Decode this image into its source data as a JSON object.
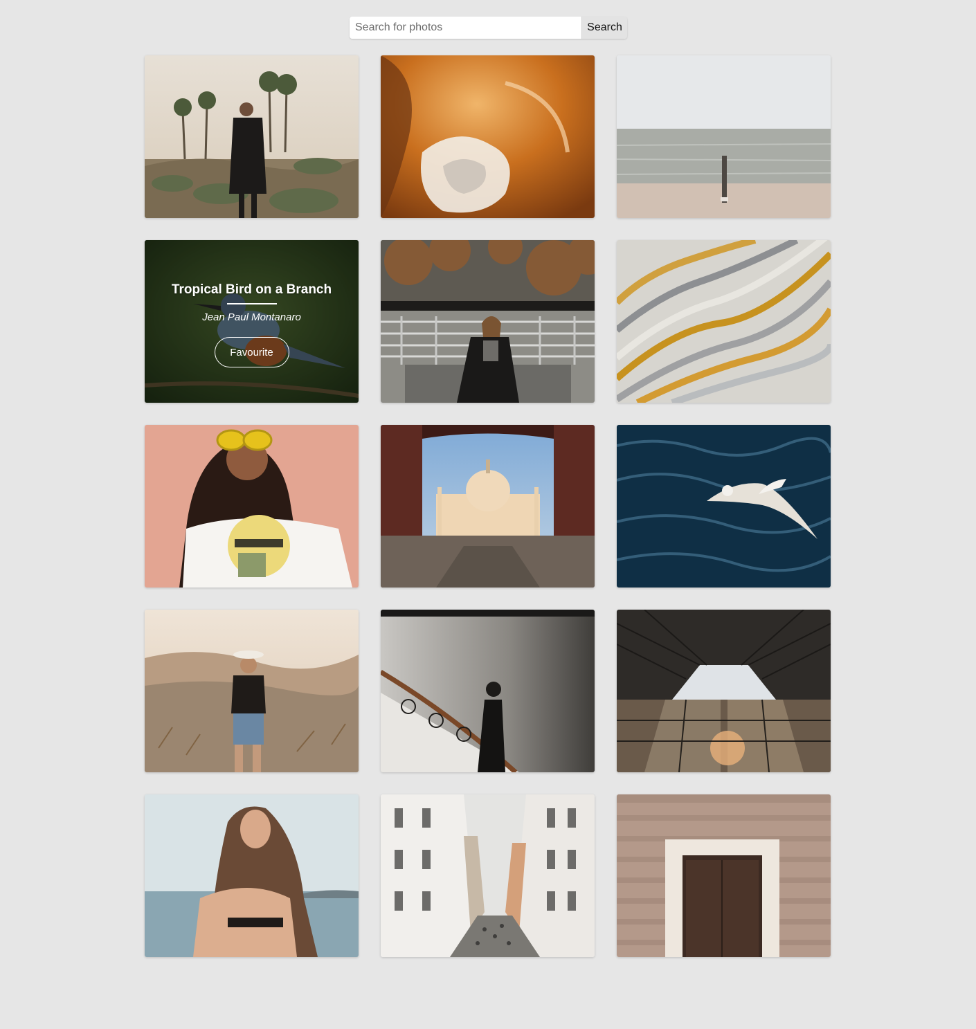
{
  "search": {
    "placeholder": "Search for photos",
    "value": "",
    "button_label": "Search"
  },
  "photos": [
    {
      "subject": "woman in black blazer in desert with palm trees"
    },
    {
      "subject": "abstract orange and white fluid texture"
    },
    {
      "subject": "calm sea with wooden post on the beach"
    },
    {
      "subject": "kingfisher bird on a branch",
      "title": "Tropical Bird on a Branch",
      "author": "Jean Paul Montanaro",
      "hover": true,
      "fav_label": "Favourite"
    },
    {
      "subject": "woman sitting on bench in front of railing and tree"
    },
    {
      "subject": "striped marble stone texture"
    },
    {
      "subject": "woman with yellow sunglasses and Studio70 t-shirt"
    },
    {
      "subject": "Taj Mahal framed by archway"
    },
    {
      "subject": "seagull flying over dark blue water"
    },
    {
      "subject": "woman in hat standing in dry landscape"
    },
    {
      "subject": "woman on ornate staircase"
    },
    {
      "subject": "glass building reflections looking up"
    },
    {
      "subject": "woman at the sea"
    },
    {
      "subject": "city street between classic buildings"
    },
    {
      "subject": "wooden door in tiled wall"
    }
  ]
}
